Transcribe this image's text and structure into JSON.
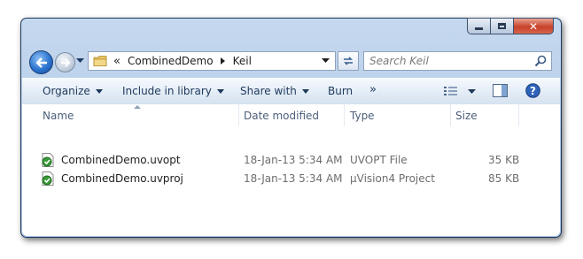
{
  "window": {
    "close_glyph": "✕"
  },
  "nav": {
    "breadcrumb_prefix": "«",
    "path": [
      "CombinedDemo",
      "Keil"
    ],
    "search_placeholder": "Search Keil"
  },
  "toolbar": {
    "organize": "Organize",
    "include_in_library": "Include in library",
    "share_with": "Share with",
    "burn": "Burn",
    "more": "»"
  },
  "columns": {
    "name": "Name",
    "date": "Date modified",
    "type": "Type",
    "size": "Size"
  },
  "files": [
    {
      "name": "CombinedDemo.uvopt",
      "date": "18-Jan-13 5:34 AM",
      "type": "UVOPT File",
      "size": "35 KB"
    },
    {
      "name": "CombinedDemo.uvproj",
      "date": "18-Jan-13 5:34 AM",
      "type": "µVision4 Project",
      "size": "85 KB"
    }
  ]
}
